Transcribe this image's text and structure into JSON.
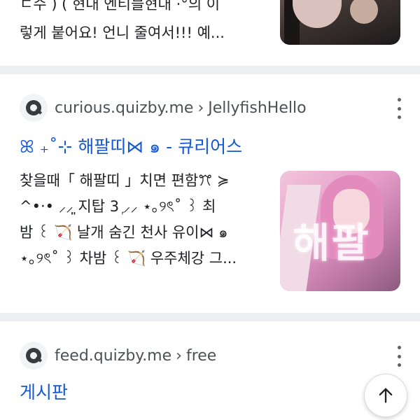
{
  "results": [
    {
      "snippet_lines": [
        "ㄷ수 ) ( 현대 엔티블현대 ·°의 이",
        "렇게 붙어요! 언니 줄여서!!! 예..."
      ]
    },
    {
      "favicon": "quizby-logo-icon",
      "domain": "curious.quizby.me",
      "separator": "›",
      "path": "JellyfishHello",
      "title": "ꕤ ₊˚⊹ 해팔띠⋈ ๑ - 큐리어스",
      "snippet_lines": [
        "찾을때「 해팔띠 」치면 편함ꔫ ≽",
        "^•‧• ⸝⸝͈ 지탑 3 ᷊⸝⸝ ⋆｡୨ৎ˚ ꒱ 최",
        "밤 ꒰ 🏹 날개 숨긴 천사 유이⋈ ๑",
        "⋆｡୨ৎ˚ ꒱ 차밤 ꒰ 🏹 우주체강 그..."
      ],
      "thumbnail_text": "해팔"
    },
    {
      "favicon": "quizby-logo-icon",
      "domain": "feed.quizby.me",
      "separator": "›",
      "path": "free",
      "title": "게시판"
    }
  ],
  "scroll_top_icon": "arrow-up-icon",
  "colors": {
    "link": "#1558d6",
    "divider": "#eceef1",
    "meta_text": "#4d5156"
  }
}
